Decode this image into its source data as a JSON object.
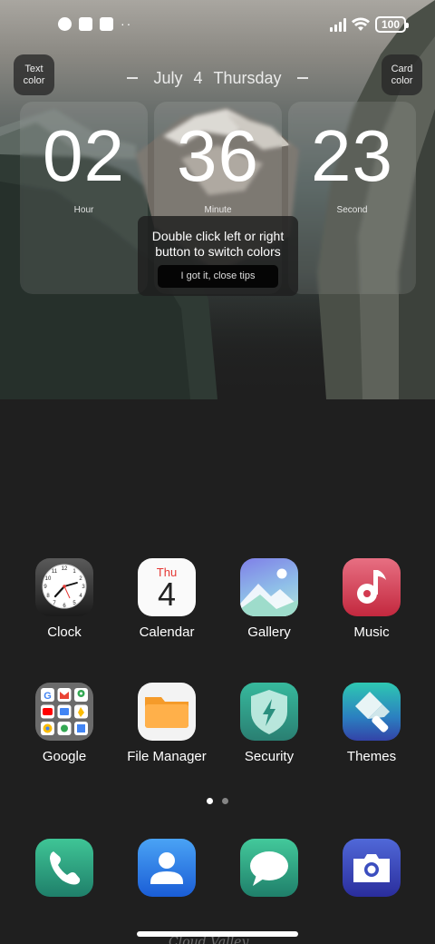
{
  "status_bar": {
    "left_icons": [
      "notification-icon-1",
      "notification-icon-2",
      "upload-icon"
    ],
    "overflow": "··",
    "battery": "100"
  },
  "widget": {
    "text_color_label": "Text\ncolor",
    "card_color_label": "Card\ncolor",
    "date": {
      "month": "July",
      "day": "4",
      "weekday": "Thursday"
    },
    "hour": {
      "value": "02",
      "label": "Hour"
    },
    "minute": {
      "value": "36",
      "label": "Minute"
    },
    "second": {
      "value": "23",
      "label": "Second"
    },
    "tip": {
      "text": "Double click left or right button to switch colors",
      "button": "I got it, close tips"
    }
  },
  "apps": [
    {
      "label": "Clock",
      "icon": "clock-icon"
    },
    {
      "label": "Calendar",
      "icon": "calendar-icon",
      "day": "Thu",
      "date": "4"
    },
    {
      "label": "Gallery",
      "icon": "gallery-icon"
    },
    {
      "label": "Music",
      "icon": "music-icon"
    },
    {
      "label": "Google",
      "icon": "google-folder-icon"
    },
    {
      "label": "File Manager",
      "icon": "folder-icon"
    },
    {
      "label": "Security",
      "icon": "shield-icon"
    },
    {
      "label": "Themes",
      "icon": "paintbrush-icon"
    }
  ],
  "dock": [
    {
      "icon": "phone-icon"
    },
    {
      "icon": "contacts-icon"
    },
    {
      "icon": "messages-icon"
    },
    {
      "icon": "camera-icon"
    }
  ],
  "pages": {
    "count": 2,
    "active": 1
  },
  "wallpaper_signature": "Cloud Valley"
}
